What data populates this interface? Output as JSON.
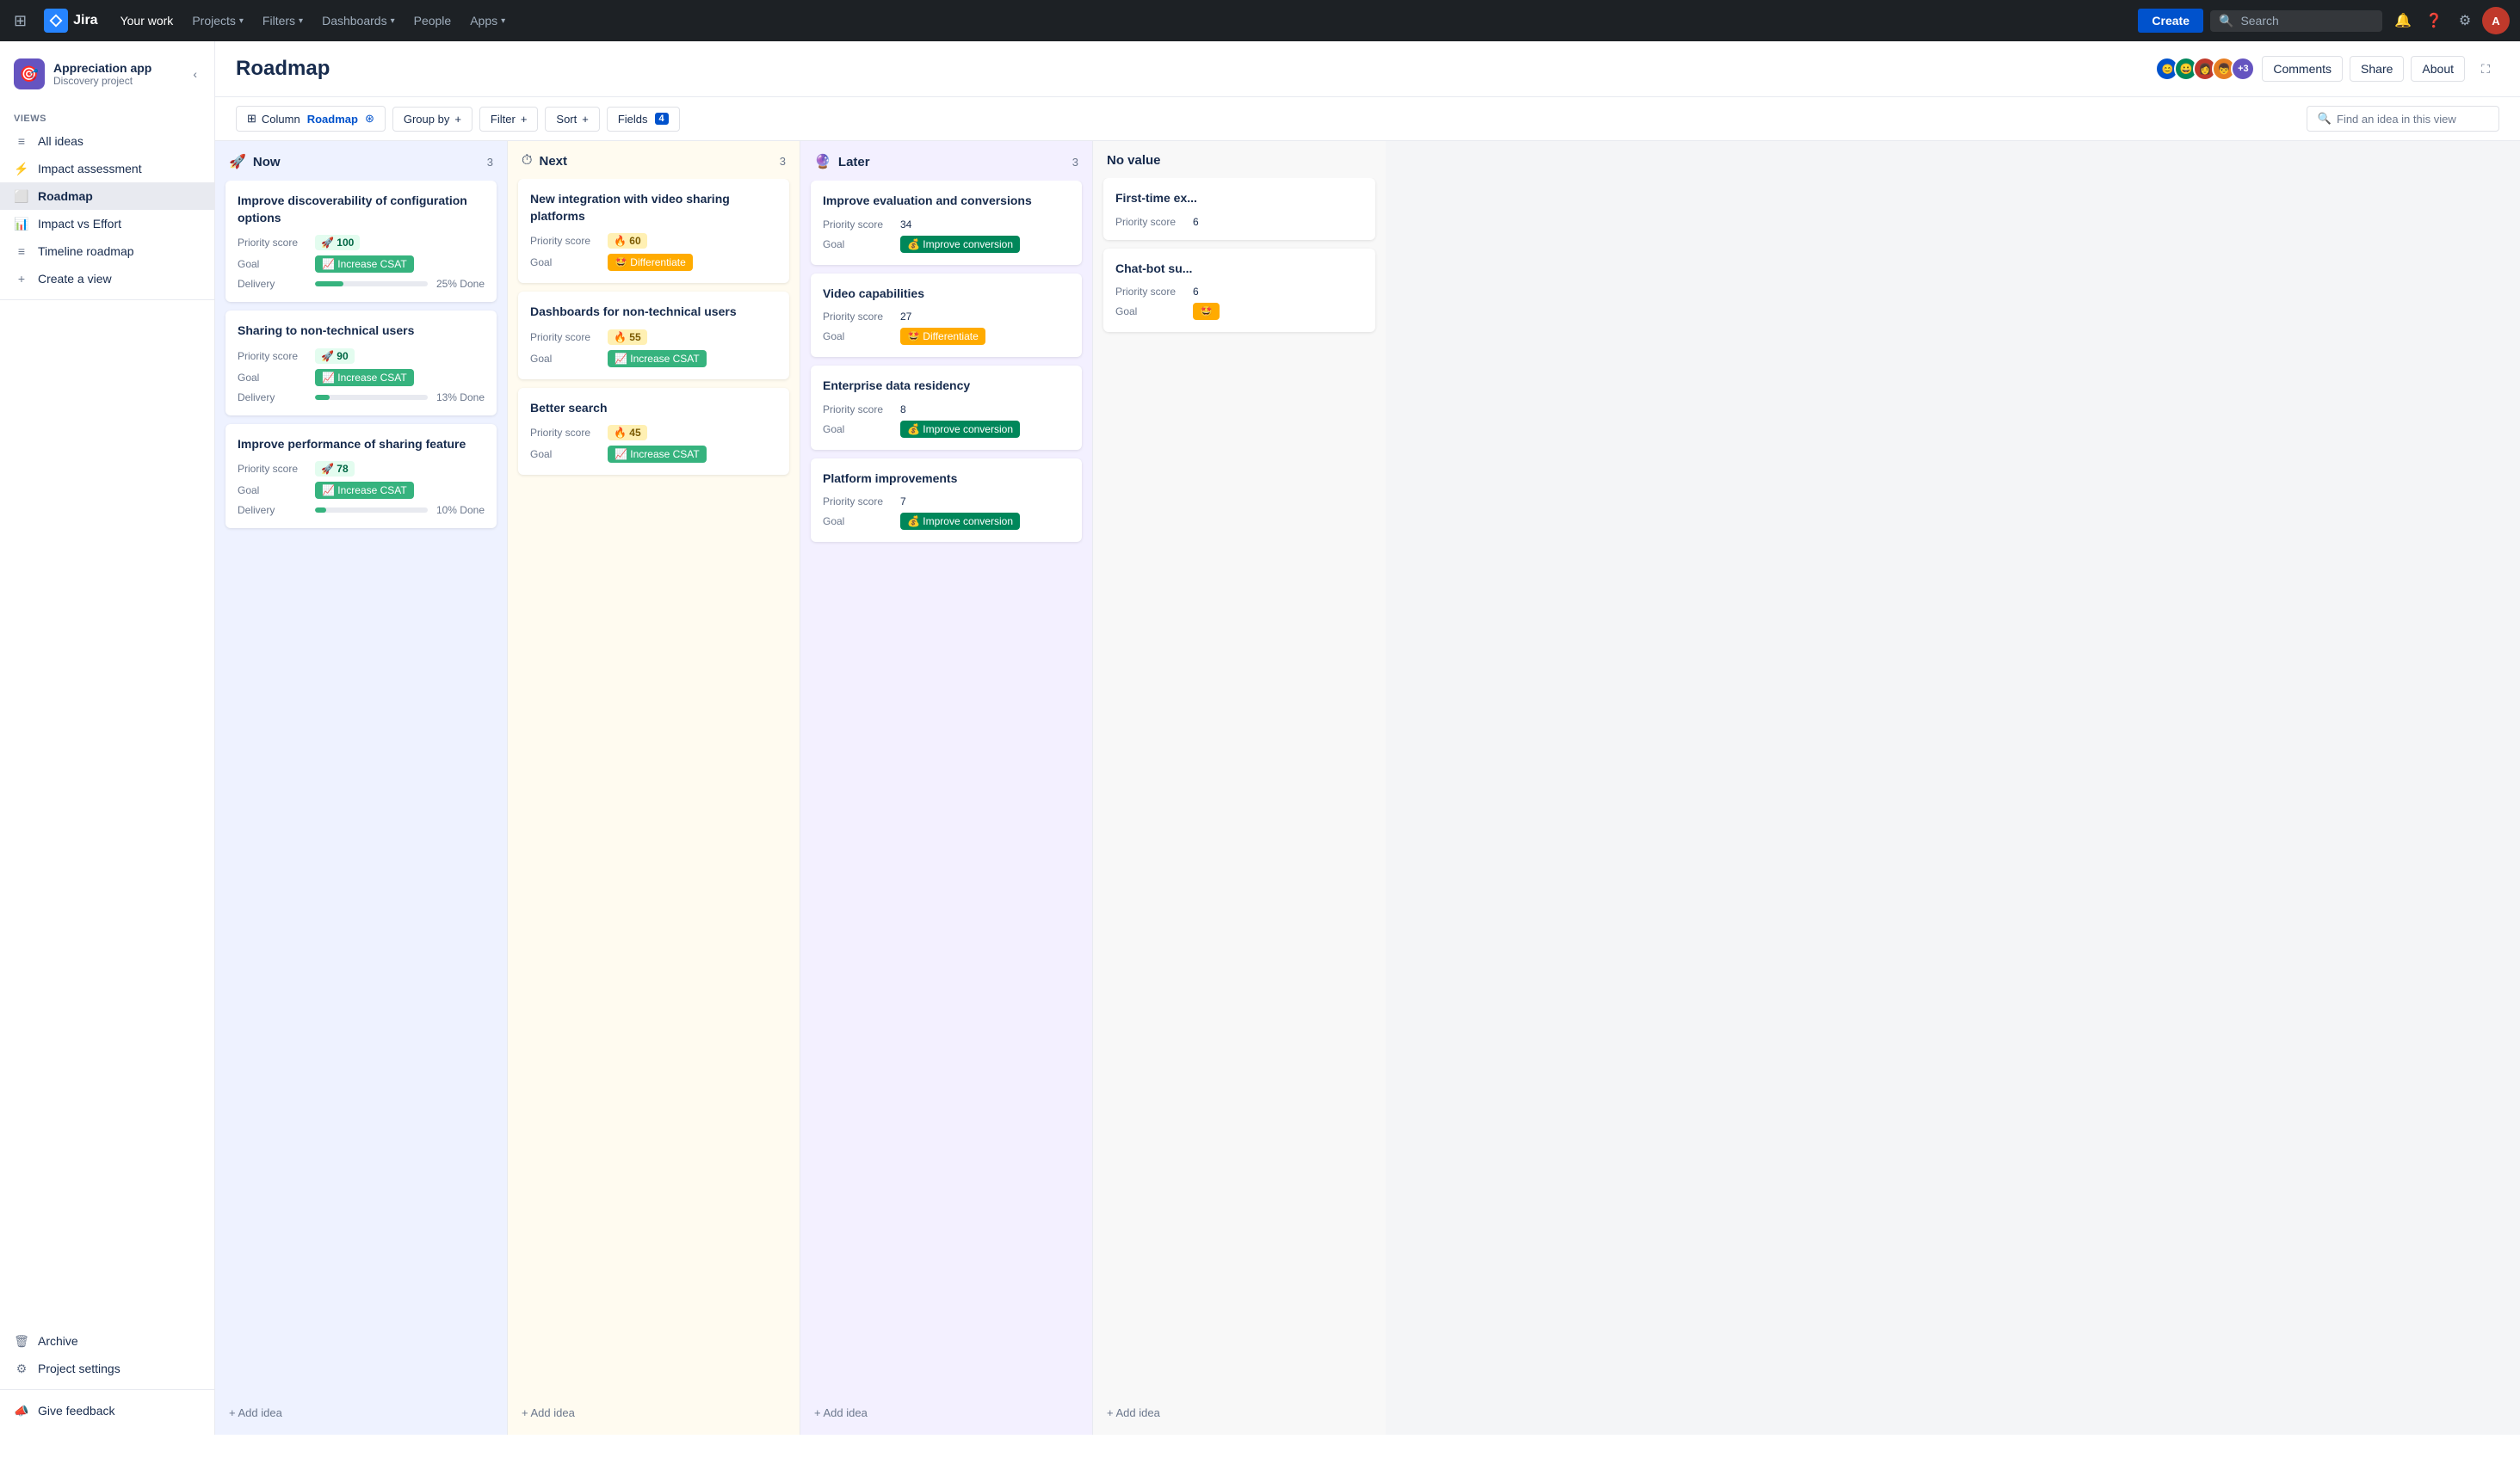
{
  "nav": {
    "logo_text": "Jira",
    "links": [
      "Your work",
      "Projects",
      "Filters",
      "Dashboards",
      "People",
      "Apps"
    ],
    "create_label": "Create",
    "search_placeholder": "Search"
  },
  "sidebar": {
    "project_name": "Appreciation app",
    "project_type": "Discovery project",
    "project_icon": "🎯",
    "views_label": "VIEWS",
    "views": [
      {
        "icon": "≡",
        "label": "All ideas",
        "active": false
      },
      {
        "icon": "⚡",
        "label": "Impact assessment",
        "active": false
      },
      {
        "icon": "⬜",
        "label": "Roadmap",
        "active": true
      },
      {
        "icon": "📊",
        "label": "Impact vs Effort",
        "active": false
      },
      {
        "icon": "≡",
        "label": "Timeline roadmap",
        "active": false
      }
    ],
    "create_view": "Create a view",
    "archive": "Archive",
    "settings": "Project settings",
    "feedback": "Give feedback"
  },
  "header": {
    "title": "Roadmap",
    "comments_label": "Comments",
    "share_label": "Share",
    "about_label": "About"
  },
  "toolbar": {
    "column_label": "Column",
    "roadmap_label": "Roadmap",
    "group_by_label": "Group by",
    "filter_label": "Filter",
    "sort_label": "Sort",
    "fields_label": "Fields",
    "fields_count": "4",
    "search_placeholder": "Find an idea in this view"
  },
  "columns": [
    {
      "id": "now",
      "icon": "🚀",
      "title": "Now",
      "count": 3,
      "bg": "now",
      "cards": [
        {
          "title": "Improve discoverability of configuration options",
          "priority_score": "100",
          "score_emoji": "🚀",
          "goal": "Increase CSAT",
          "goal_emoji": "📈",
          "goal_color": "csat",
          "delivery": 25,
          "delivery_label": "25% Done"
        },
        {
          "title": "Sharing to non-technical users",
          "priority_score": "90",
          "score_emoji": "🚀",
          "goal": "Increase CSAT",
          "goal_emoji": "📈",
          "goal_color": "csat",
          "delivery": 13,
          "delivery_label": "13% Done"
        },
        {
          "title": "Improve performance of sharing feature",
          "priority_score": "78",
          "score_emoji": "🚀",
          "goal": "Increase CSAT",
          "goal_emoji": "📈",
          "goal_color": "csat",
          "delivery": 10,
          "delivery_label": "10% Done"
        }
      ]
    },
    {
      "id": "next",
      "icon": "⏱",
      "title": "Next",
      "count": 3,
      "bg": "next",
      "cards": [
        {
          "title": "New integration with video sharing platforms",
          "priority_score": "60",
          "score_emoji": "🔥",
          "goal": "Differentiate",
          "goal_emoji": "🤩",
          "goal_color": "diff",
          "delivery": null,
          "delivery_label": null
        },
        {
          "title": "Dashboards for non-technical users",
          "priority_score": "55",
          "score_emoji": "🔥",
          "goal": "Increase CSAT",
          "goal_emoji": "📈",
          "goal_color": "csat",
          "delivery": null,
          "delivery_label": null
        },
        {
          "title": "Better search",
          "priority_score": "45",
          "score_emoji": "🔥",
          "goal": "Increase CSAT",
          "goal_emoji": "📈",
          "goal_color": "csat",
          "delivery": null,
          "delivery_label": null
        }
      ]
    },
    {
      "id": "later",
      "icon": "🔮",
      "title": "Later",
      "count": 3,
      "bg": "later",
      "cards": [
        {
          "title": "Improve evaluation and conversions",
          "priority_score": "34",
          "score_emoji": null,
          "goal": "Improve conversion",
          "goal_emoji": "💰",
          "goal_color": "conv",
          "delivery": null,
          "delivery_label": null
        },
        {
          "title": "Video capabilities",
          "priority_score": "27",
          "score_emoji": null,
          "goal": "Differentiate",
          "goal_emoji": "🤩",
          "goal_color": "diff",
          "delivery": null,
          "delivery_label": null
        },
        {
          "title": "Enterprise data residency",
          "priority_score": "8",
          "score_emoji": null,
          "goal": "Improve conversion",
          "goal_emoji": "💰",
          "goal_color": "conv",
          "delivery": null,
          "delivery_label": null
        },
        {
          "title": "Platform improvements",
          "priority_score": "7",
          "score_emoji": null,
          "goal": "Improve conversion",
          "goal_emoji": "💰",
          "goal_color": "conv",
          "delivery": null,
          "delivery_label": null
        }
      ]
    },
    {
      "id": "no-value",
      "icon": null,
      "title": "No value",
      "count": null,
      "bg": "novalue",
      "cards": [
        {
          "title": "First-time ex...",
          "priority_score": "6",
          "score_emoji": null,
          "goal": null,
          "goal_emoji": null,
          "goal_color": null,
          "delivery": null,
          "delivery_label": null,
          "truncated": true
        },
        {
          "title": "Chat-bot su...",
          "priority_score": "6",
          "score_emoji": null,
          "goal": null,
          "goal_emoji": "🤩",
          "goal_color": "diff",
          "delivery": null,
          "delivery_label": null,
          "truncated": true
        }
      ]
    }
  ],
  "labels": {
    "priority_score": "Priority score",
    "goal": "Goal",
    "delivery": "Delivery",
    "add_idea": "+ Add idea"
  }
}
